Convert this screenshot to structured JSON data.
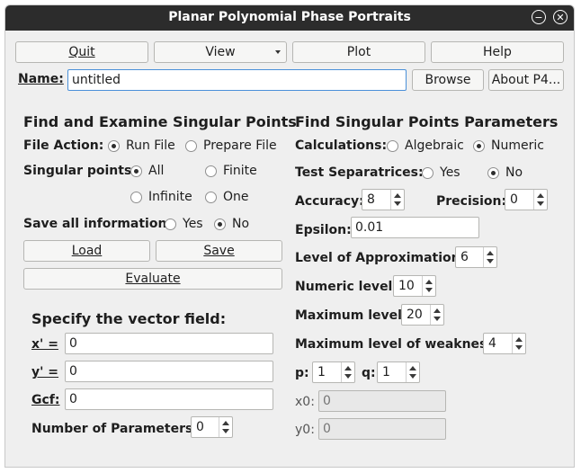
{
  "window": {
    "title": "Planar Polynomial Phase Portraits"
  },
  "toolbar": {
    "quit": "Quit",
    "view": "View",
    "plot": "Plot",
    "help": "Help"
  },
  "name_row": {
    "label": "Name:",
    "value": "untitled",
    "browse": "Browse",
    "about": "About P4..."
  },
  "left": {
    "heading": "Find and Examine Singular Points",
    "file_action": {
      "label": "File Action:",
      "options": [
        "Run File",
        "Prepare File"
      ],
      "selected": "Run File"
    },
    "singular_points": {
      "label": "Singular points:",
      "options": [
        "All",
        "Finite",
        "Infinite",
        "One"
      ],
      "selected": "All"
    },
    "save_all": {
      "label": "Save all information:",
      "options": [
        "Yes",
        "No"
      ],
      "selected": "No"
    },
    "load": "Load",
    "save": "Save",
    "evaluate": "Evaluate"
  },
  "vector_field": {
    "heading": "Specify the vector field:",
    "x_label": "x' =",
    "x_value": "0",
    "y_label": "y' =",
    "y_value": "0",
    "gcf_label": "Gcf:",
    "gcf_value": "0",
    "num_params_label": "Number of Parameters:",
    "num_params_value": "0"
  },
  "right": {
    "heading": "Find Singular Points Parameters",
    "calculations": {
      "label": "Calculations:",
      "options": [
        "Algebraic",
        "Numeric"
      ],
      "selected": "Numeric"
    },
    "test_separatrices": {
      "label": "Test Separatrices:",
      "options": [
        "Yes",
        "No"
      ],
      "selected": "No"
    },
    "accuracy": {
      "label": "Accuracy:",
      "value": "8"
    },
    "precision": {
      "label": "Precision:",
      "value": "0"
    },
    "epsilon": {
      "label": "Epsilon:",
      "value": "0.01"
    },
    "level_approx": {
      "label": "Level of Approximation:",
      "value": "6"
    },
    "numeric_level": {
      "label": "Numeric level:",
      "value": "10"
    },
    "maximum_level": {
      "label": "Maximum level:",
      "value": "20"
    },
    "max_weakness": {
      "label": "Maximum level of weakness:",
      "value": "4"
    },
    "p": {
      "label": "p:",
      "value": "1"
    },
    "q": {
      "label": "q:",
      "value": "1"
    },
    "x0": {
      "label": "x0:",
      "placeholder": "0"
    },
    "y0": {
      "label": "y0:",
      "placeholder": "0"
    }
  }
}
